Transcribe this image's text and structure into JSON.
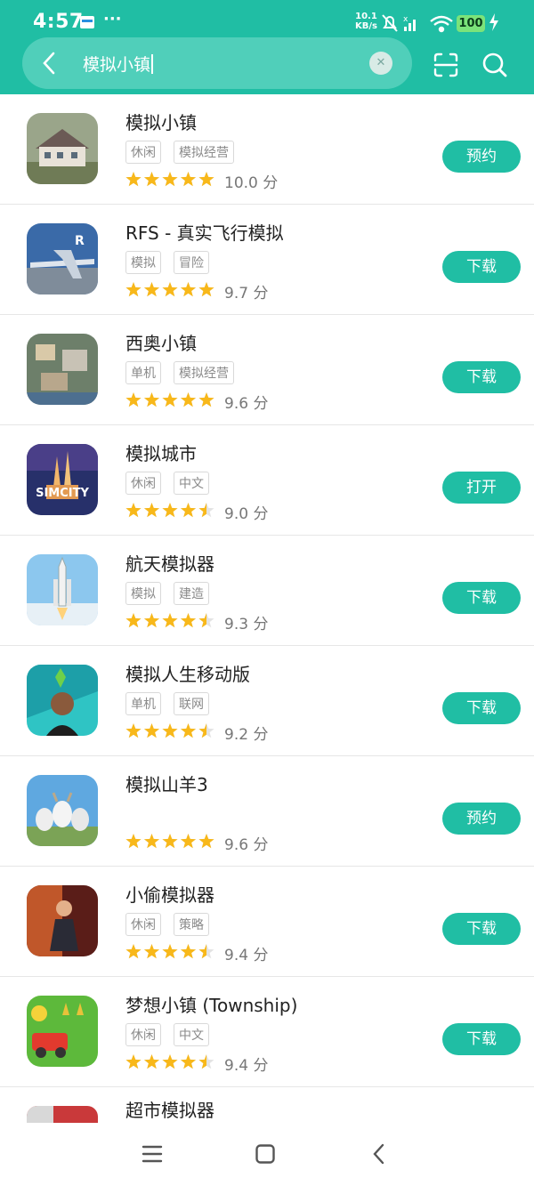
{
  "status_bar": {
    "time": "4:57",
    "more": "···",
    "net_speed_value": "10.1",
    "net_speed_unit": "KB/s",
    "battery": "100"
  },
  "search": {
    "query": "模拟小镇",
    "clear_icon": "close-icon",
    "scan_icon": "scan-icon",
    "search_icon": "search-icon"
  },
  "colors": {
    "accent": "#20bea4",
    "star": "#f8b81a",
    "star_empty": "#e3e3e3"
  },
  "apps": [
    {
      "name": "模拟小镇",
      "tags": [
        "休闲",
        "模拟经营"
      ],
      "rating": 5.0,
      "score": "10.0 分",
      "action": "预约"
    },
    {
      "name": "RFS - 真实飞行模拟",
      "tags": [
        "模拟",
        "冒险"
      ],
      "rating": 5.0,
      "score": "9.7 分",
      "action": "下载"
    },
    {
      "name": "西奥小镇",
      "tags": [
        "单机",
        "模拟经营"
      ],
      "rating": 5.0,
      "score": "9.6 分",
      "action": "下载"
    },
    {
      "name": "模拟城市",
      "tags": [
        "休闲",
        "中文"
      ],
      "rating": 4.5,
      "score": "9.0 分",
      "action": "打开",
      "icon_text": "SIMCITY"
    },
    {
      "name": "航天模拟器",
      "tags": [
        "模拟",
        "建造"
      ],
      "rating": 4.5,
      "score": "9.3 分",
      "action": "下载"
    },
    {
      "name": "模拟人生移动版",
      "tags": [
        "单机",
        "联网"
      ],
      "rating": 4.5,
      "score": "9.2 分",
      "action": "下载"
    },
    {
      "name": "模拟山羊3",
      "tags": [],
      "rating": 5.0,
      "score": "9.6 分",
      "action": "预约"
    },
    {
      "name": "小偷模拟器",
      "tags": [
        "休闲",
        "策略"
      ],
      "rating": 4.5,
      "score": "9.4 分",
      "action": "下载"
    },
    {
      "name": "梦想小镇 (Township)",
      "tags": [
        "休闲",
        "中文"
      ],
      "rating": 4.5,
      "score": "9.4 分",
      "action": "下载"
    },
    {
      "name": "超市模拟器",
      "tags": [],
      "rating": null,
      "score": "",
      "action": ""
    }
  ],
  "navbar": {
    "menu_icon": "menu-icon",
    "home_icon": "home-icon",
    "back_icon": "back-icon"
  }
}
